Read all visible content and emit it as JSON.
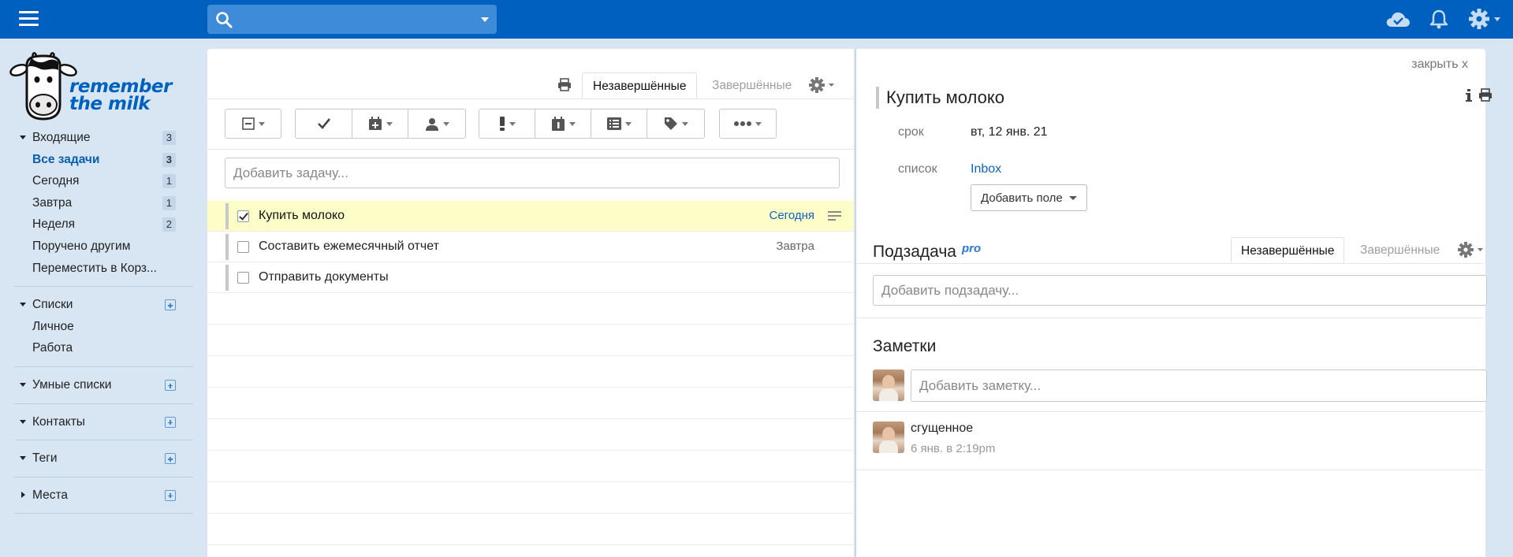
{
  "topbar": {
    "search_placeholder": "",
    "icons": [
      "menu-icon",
      "search-icon",
      "cloud-sync-icon",
      "bell-icon",
      "gear-icon"
    ]
  },
  "logo": {
    "line1": "remember",
    "line2": "the milk"
  },
  "sidebar": {
    "inbox": {
      "label": "Входящие",
      "count": "3",
      "items": [
        {
          "label": "Все задачи",
          "count": "3",
          "active": true
        },
        {
          "label": "Сегодня",
          "count": "1"
        },
        {
          "label": "Завтра",
          "count": "1"
        },
        {
          "label": "Неделя",
          "count": "2"
        },
        {
          "label": "Поручено другим",
          "count": ""
        },
        {
          "label": "Переместить в Корз...",
          "count": ""
        }
      ]
    },
    "lists": {
      "label": "Списки",
      "items": [
        {
          "label": "Личное"
        },
        {
          "label": "Работа"
        }
      ]
    },
    "smart_lists": {
      "label": "Умные списки"
    },
    "contacts": {
      "label": "Контакты"
    },
    "tags": {
      "label": "Теги"
    },
    "places": {
      "label": "Места"
    }
  },
  "tasklist": {
    "tabs": {
      "incomplete": "Незавершённые",
      "completed": "Завершённые"
    },
    "add_placeholder": "Добавить задачу...",
    "tasks": [
      {
        "name": "Купить молоко",
        "due": "Сегодня",
        "checked": true,
        "selected": true
      },
      {
        "name": "Составить ежемесячный отчет",
        "due": "Завтра",
        "checked": false
      },
      {
        "name": "Отправить документы",
        "due": "",
        "checked": false
      }
    ]
  },
  "details": {
    "close_label": "закрыть x",
    "title": "Купить молоко",
    "due_label": "срок",
    "due_value": "вт, 12 янв. 21",
    "list_label": "список",
    "list_value": "Inbox",
    "add_field_label": "Добавить поле",
    "subtasks": {
      "heading": "Подзадача",
      "pro_badge": "pro",
      "tab_incomplete": "Незавершённые",
      "tab_completed": "Завершённые",
      "add_placeholder": "Добавить подзадачу..."
    },
    "notes": {
      "heading": "Заметки",
      "add_placeholder": "Добавить заметку...",
      "items": [
        {
          "text": "сгущенное",
          "time": "6 янв. в 2:19pm"
        }
      ]
    }
  },
  "colors": {
    "topbar": "#0060bf",
    "sidebar_bg": "#d8e6f3",
    "selected_row": "#fdfdc8",
    "link": "#0b63c1"
  }
}
